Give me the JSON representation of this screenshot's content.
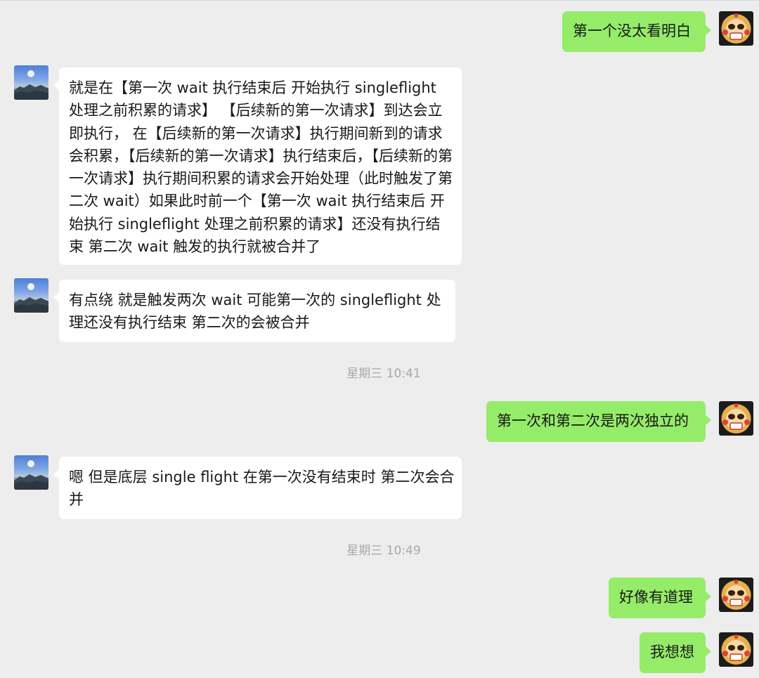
{
  "messages": [
    {
      "side": "out",
      "text": "第一个没太看明白",
      "avatar_icon": "cartoon-mascot-avatar-icon"
    },
    {
      "side": "in",
      "text": "就是在【第一次 wait 执行结束后  开始执行 singleflight 处理之前积累的请求】  【后续新的第一次请求】到达会立即执行， 在【后续新的第一次请求】执行期间新到的请求会积累，【后续新的第一次请求】执行结束后，【后续新的第一次请求】执行期间积累的请求会开始处理（此时触发了第二次 wait）如果此时前一个【第一次 wait 执行结束后  开始执行 singleflight 处理之前积累的请求】还没有执行结束  第二次 wait 触发的执行就被合并了",
      "avatar_icon": "mountain-landscape-avatar-icon"
    },
    {
      "side": "in",
      "text": "有点绕    就是触发两次 wait 可能第一次的 singleflight 处理还没有执行结束  第二次的会被合并",
      "avatar_icon": "mountain-landscape-avatar-icon"
    },
    {
      "side": "out",
      "text": "第一次和第二次是两次独立的",
      "avatar_icon": "cartoon-mascot-avatar-icon"
    },
    {
      "side": "in",
      "text": "嗯  但是底层 single flight  在第一次没有结束时  第二次会合并",
      "avatar_icon": "mountain-landscape-avatar-icon"
    },
    {
      "side": "out",
      "text": "好像有道理",
      "avatar_icon": "cartoon-mascot-avatar-icon"
    },
    {
      "side": "out",
      "text": "我想想",
      "avatar_icon": "cartoon-mascot-avatar-icon"
    }
  ],
  "timestamps": [
    "星期三 10:41",
    "星期三 10:49"
  ],
  "colors": {
    "background": "#ededed",
    "incoming_bubble": "#ffffff",
    "outgoing_bubble": "#95ec69",
    "text": "#191919",
    "timestamp": "#a8a8a8"
  }
}
